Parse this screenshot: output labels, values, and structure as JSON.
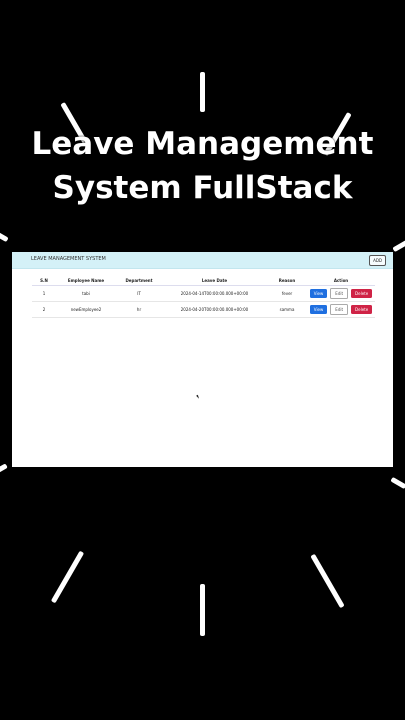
{
  "overlay": {
    "title_line1": "Leave Management",
    "title_line2": "System FullStack"
  },
  "app": {
    "brand": "LEAVE MANAGEMENT SYSTEM",
    "add_label": "ADD"
  },
  "table": {
    "headers": [
      "S.N",
      "Employee Name",
      "Department",
      "Leave Date",
      "Reason",
      "Action"
    ],
    "rows": [
      {
        "sn": "1",
        "name": "tabi",
        "department": "IT",
        "leave_date": "2024-04-14T00:00:00.000+00:00",
        "reason": "fever",
        "view": "View",
        "edit": "Edit",
        "delete": "Delete"
      },
      {
        "sn": "2",
        "name": "newEmployee2",
        "department": "hr",
        "leave_date": "2024-04-20T00:00:00.000+00:00",
        "reason": "samma",
        "view": "View",
        "edit": "Edit",
        "delete": "Delete"
      }
    ]
  }
}
